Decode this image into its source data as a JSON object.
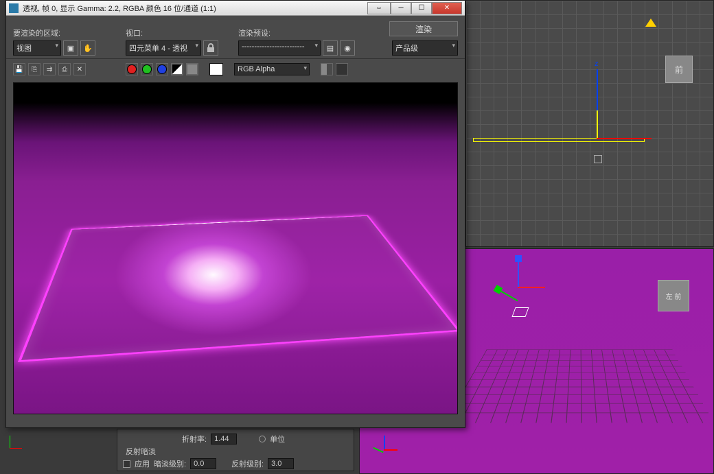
{
  "window": {
    "title": "透视, 帧 0, 显示 Gamma: 2.2, RGBA 颜色 16 位/通道 (1:1)",
    "minimize": "─",
    "maximize": "☐",
    "close": "✕",
    "drag": "⇔"
  },
  "toolbar": {
    "region_label": "要渲染的区域:",
    "region_value": "视图",
    "viewport_label": "视口:",
    "viewport_value": "四元菜单 4 - 透视",
    "preset_label": "渲染预设:",
    "preset_value": "-------------------------",
    "product_value": "产品级",
    "render_button": "渲染"
  },
  "toolbar2": {
    "channel_value": "RGB Alpha",
    "colors": {
      "r": "#e02020",
      "g": "#20c020",
      "b": "#2040e0"
    }
  },
  "viewport_labels": {
    "front": "前",
    "left_front": "左 前"
  },
  "bottom_panel": {
    "ior_label": "折射率:",
    "ior_value": "1.44",
    "unit_label": "单位",
    "reflect_dim_label": "反射暗淡",
    "apply_label": "应用",
    "dim_level_label": "暗淡级别:",
    "dim_level_value": "0.0",
    "refl_level_label": "反射级别:",
    "refl_level_value": "3.0"
  }
}
